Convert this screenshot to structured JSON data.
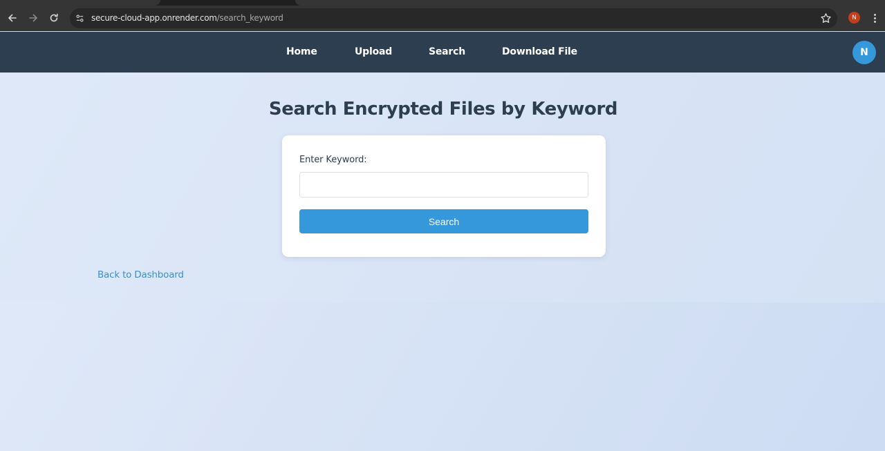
{
  "browser": {
    "url_host": "secure-cloud-app.onrender.com",
    "url_path": "/search_keyword",
    "profile_initial": "N",
    "icons": [
      "arrow-left-icon",
      "arrow-right-icon",
      "reload-icon",
      "site-settings-icon",
      "star-icon",
      "kebab-menu-icon"
    ]
  },
  "nav": {
    "links": [
      {
        "label": "Home"
      },
      {
        "label": "Upload"
      },
      {
        "label": "Search"
      },
      {
        "label": "Download File"
      }
    ],
    "avatar_initial": "N"
  },
  "main": {
    "title": "Search Encrypted Files by Keyword",
    "form": {
      "label": "Enter Keyword:",
      "input_value": "",
      "button_label": "Search"
    },
    "back_link": "Back to Dashboard"
  },
  "colors": {
    "nav_bg": "#2c3e50",
    "accent": "#3498db",
    "title": "#2c3e50",
    "link": "#3a8fd0"
  }
}
